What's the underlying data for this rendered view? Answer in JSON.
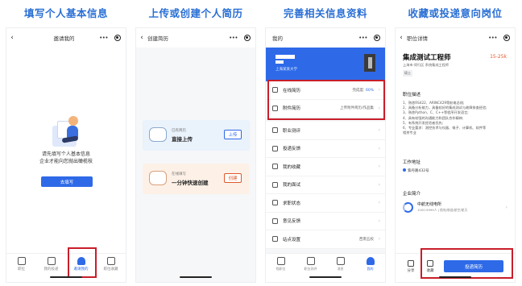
{
  "step_titles": [
    "填写个人基本信息",
    "上传或创建个人简历",
    "完善相关信息资料",
    "收藏或投递意向岗位"
  ],
  "phone1": {
    "nav_title": "邀请我的",
    "message_line1": "请先填写个人基本信息",
    "message_line2": "企业才能向您抛出橄榄枝",
    "fill_button": "去填写",
    "tabs": [
      "职位",
      "我的投递",
      "邀请我的",
      "职位收藏"
    ]
  },
  "phone2": {
    "nav_title": "创建简历",
    "card1_small": "已有简历",
    "card1_big": "直接上传",
    "card1_button": "上传",
    "card2_small": "在线填写",
    "card2_big": "一分钟快速创建",
    "card2_button": "创建"
  },
  "phone3": {
    "nav_title": "我的",
    "school": "上海某某大学",
    "menu": [
      {
        "label": "在线简历",
        "value_prefix": "完成度:",
        "value_highlight": "60%"
      },
      {
        "label": "附件简历",
        "value_prefix": "上传附件简历/作品集",
        "value_highlight": ""
      },
      {
        "label": "职业测评",
        "value_prefix": "",
        "value_highlight": ""
      },
      {
        "label": "投递反馈",
        "value_prefix": "",
        "value_highlight": ""
      },
      {
        "label": "我的收藏",
        "value_prefix": "",
        "value_highlight": ""
      },
      {
        "label": "我的面试",
        "value_prefix": "",
        "value_highlight": ""
      },
      {
        "label": "求职状态",
        "value_prefix": "",
        "value_highlight": ""
      },
      {
        "label": "意见反馈",
        "value_prefix": "",
        "value_highlight": ""
      },
      {
        "label": "站点设置",
        "value_prefix": "西南五校",
        "value_highlight": ""
      }
    ],
    "tabs": [
      "找职位",
      "职业测评",
      "消息",
      "我的"
    ]
  },
  "phone4": {
    "nav_title": "职位详情",
    "job_title": "集成测试工程师",
    "salary": "15-25k",
    "meta": "上海市·闵行区  系统集成工程师",
    "tag": "硕士",
    "desc_heading": "职位描述",
    "desc_lines": [
      "1、熟悉RS422、ARINC429等航电总线;",
      "2、具备分析能力，具备较好的集成测试与故障排查经验;",
      "3、熟悉Python、C、C++等程序开发语言;",
      "4、具有较强的沟通能力和团队合作精神;",
      "5、有系统开发经验者优先;",
      "6、专业要求：测控技术与仪器、电子、计算机、软件等",
      "相关专业"
    ],
    "address_heading": "工作地址",
    "address": "紫丹路432号",
    "company_heading": "企业简介",
    "company_name": "中航无线电所",
    "company_info": "1000-9999人 | 航电/制造/航空/航天",
    "share_label": "分享",
    "favorite_label": "收藏",
    "deliver_button": "投递简历"
  },
  "colors": {
    "accent": "#2e6ae8",
    "highlight": "#c81e2a",
    "title": "#2a6fd4"
  }
}
